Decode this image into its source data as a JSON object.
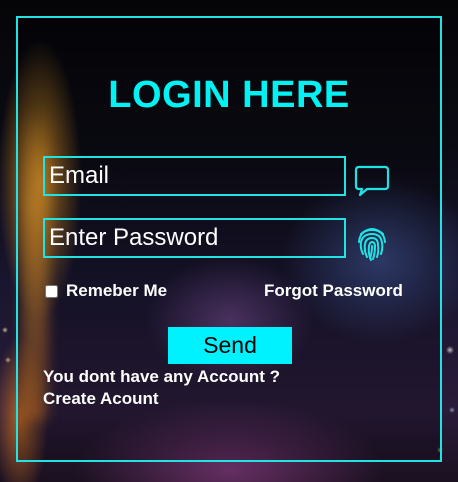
{
  "login": {
    "title": "LOGIN HERE",
    "email_placeholder": "Email",
    "password_placeholder": "Enter Password",
    "remember_label": "Remeber Me",
    "forgot_label": "Forgot Password",
    "send_label": "Send",
    "no_account_text": "You dont have any Account ?",
    "create_account_label": "Create Acount"
  },
  "icons": {
    "email": "chat-bubble-icon",
    "password": "fingerprint-icon"
  },
  "colors": {
    "accent": "#00f2f2",
    "button": "#00f2ff",
    "text": "#ffffff"
  }
}
